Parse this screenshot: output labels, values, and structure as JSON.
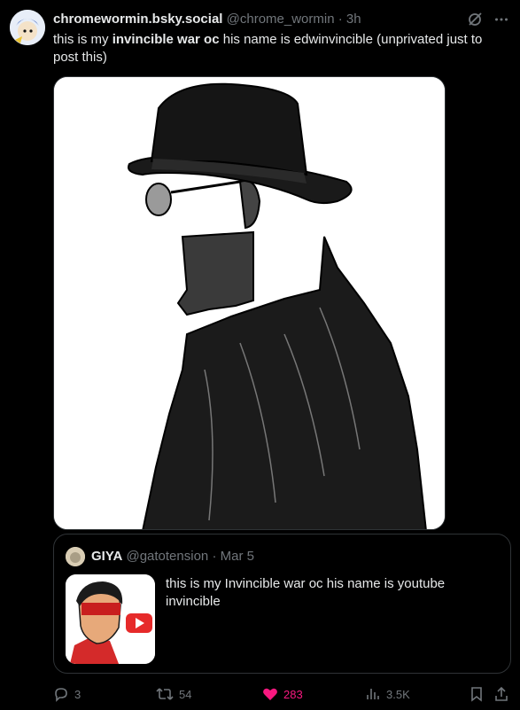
{
  "post": {
    "display_name": "chromewormin.bsky.social",
    "handle": "@chrome_wormin",
    "separator": "·",
    "time": "3h",
    "text_before": "this is my ",
    "text_bold": "invincible war oc",
    "text_after": " his name is edwinvincible (unprivated just to post this)"
  },
  "quote": {
    "display_name": "GIYA",
    "handle": "@gatotension",
    "separator": "·",
    "date": "Mar 5",
    "text": "this is my Invincible war oc his name is youtube invincible"
  },
  "actions": {
    "replies": "3",
    "reposts": "54",
    "likes": "283",
    "views": "3.5K"
  },
  "colors": {
    "background": "#000000",
    "text": "#e7e9ea",
    "muted": "#71767b",
    "like": "#f91880",
    "border": "#2f3336"
  },
  "icons": [
    "grok-icon",
    "more-icon",
    "reply-icon",
    "repost-icon",
    "heart-icon",
    "views-icon",
    "bookmark-icon",
    "share-icon"
  ]
}
